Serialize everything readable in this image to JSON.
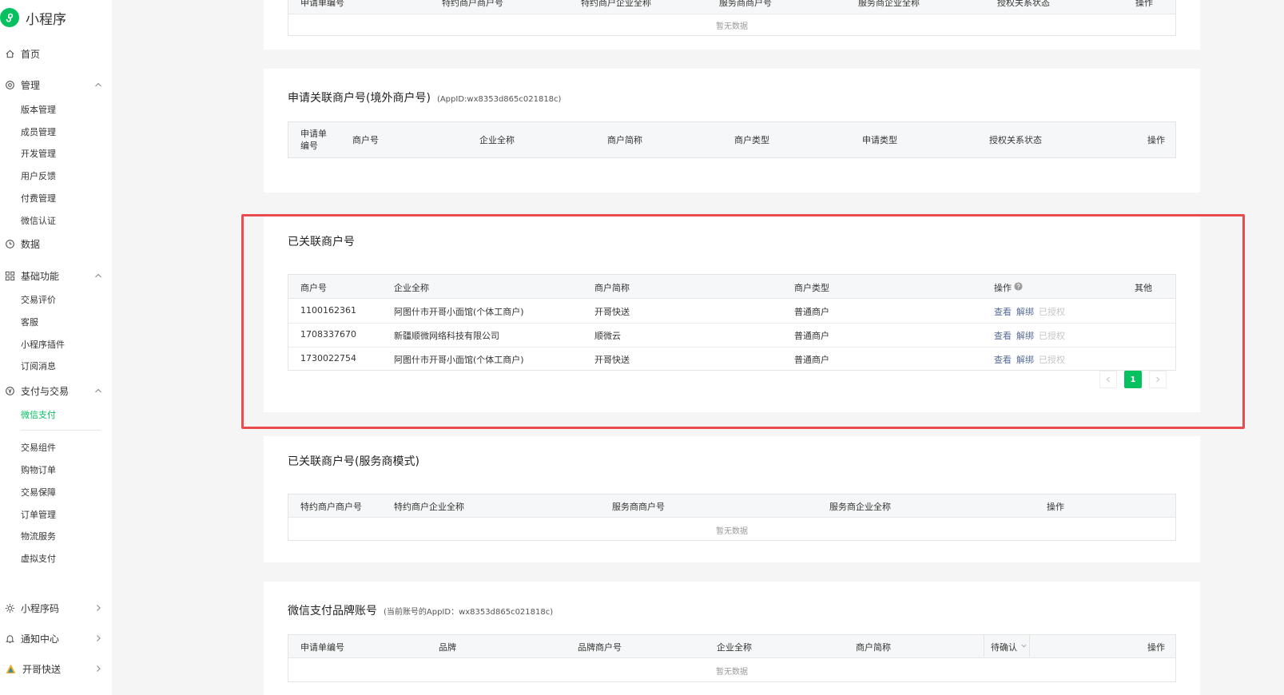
{
  "app": {
    "title": "小程序",
    "accent": "#07c160"
  },
  "nav": {
    "home": "首页",
    "manage": "管理",
    "manage_items": [
      "版本管理",
      "成员管理",
      "开发管理",
      "用户反馈",
      "付费管理",
      "微信认证"
    ],
    "data": "数据",
    "basic": "基础功能",
    "basic_items": [
      "交易评价",
      "客服",
      "小程序插件",
      "订阅消息"
    ],
    "pay": "支付与交易",
    "pay_active": "微信支付",
    "pay_items": [
      "交易组件",
      "购物订单",
      "交易保障",
      "订单管理",
      "物流服务",
      "虚拟支付"
    ],
    "qrcode": "小程序码",
    "notify": "通知中心",
    "account": "开哥快送"
  },
  "top_table": {
    "headers": [
      "申请单编号",
      "特约商户商户号",
      "特约商户企业全称",
      "服务商商户号",
      "服务商企业全称",
      "授权关系状态",
      "操作"
    ],
    "empty": "暂无数据"
  },
  "overseas": {
    "title": "申请关联商户号(境外商户号)",
    "appid": "(AppID:wx8353d865c021818c)",
    "headers": [
      "申请单编号",
      "商户号",
      "企业全称",
      "商户简称",
      "商户类型",
      "申请类型",
      "授权关系状态",
      "操作"
    ]
  },
  "linked": {
    "title": "已关联商户号",
    "headers": [
      "商户号",
      "企业全称",
      "商户简称",
      "商户类型",
      "操作",
      "其他"
    ],
    "rows": [
      {
        "id": "1100162361",
        "company": "阿图什市开哥小面馆(个体工商户)",
        "short": "开哥快送",
        "type": "普通商户",
        "view": "查看",
        "unbind": "解绑",
        "auth": "已授权"
      },
      {
        "id": "1708337670",
        "company": "新疆顺微网络科技有限公司",
        "short": "顺微云",
        "type": "普通商户",
        "view": "查看",
        "unbind": "解绑",
        "auth": "已授权"
      },
      {
        "id": "1730022754",
        "company": "阿图什市开哥小面馆(个体工商户)",
        "short": "开哥快送",
        "type": "普通商户",
        "view": "查看",
        "unbind": "解绑",
        "auth": "已授权"
      }
    ],
    "page": "1"
  },
  "service": {
    "title": "已关联商户号(服务商模式)",
    "headers": [
      "特约商户商户号",
      "特约商户企业全称",
      "服务商商户号",
      "服务商企业全称",
      "操作"
    ],
    "empty": "暂无数据"
  },
  "brand": {
    "title": "微信支付品牌账号",
    "appid": "(当前账号的AppID：wx8353d865c021818c)",
    "headers": [
      "申请单编号",
      "品牌",
      "品牌商户号",
      "企业全称",
      "商户简称",
      "操作"
    ],
    "status_filter": "待确认",
    "empty": "暂无数据"
  }
}
